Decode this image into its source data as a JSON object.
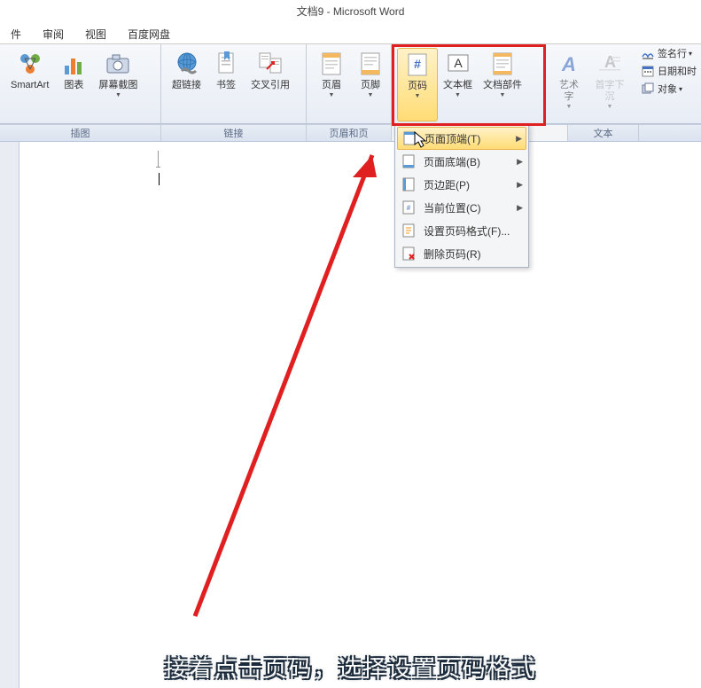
{
  "title": "文档9 - Microsoft Word",
  "menu": {
    "items": [
      "件",
      "审阅",
      "视图",
      "百度网盘"
    ]
  },
  "ribbon": {
    "smartart": "SmartArt",
    "chart": "图表",
    "screenshot": "屏幕截图",
    "hyperlink": "超链接",
    "bookmark": "书签",
    "crossref": "交叉引用",
    "header": "页眉",
    "footer": "页脚",
    "pagenum": "页码",
    "textbox": "文本框",
    "docparts": "文档部件",
    "wordart": "艺术字",
    "dropcap": "首字下沉"
  },
  "groups": {
    "illustration": "插图",
    "links": "链接",
    "headerfooter": "页眉和页",
    "text": "文本"
  },
  "dropdown": {
    "top": "页面顶端(T)",
    "bottom": "页面底端(B)",
    "margin": "页边距(P)",
    "current": "当前位置(C)",
    "format": "设置页码格式(F)...",
    "remove": "删除页码(R)"
  },
  "side": {
    "sign": "签名行",
    "datetime": "日期和时",
    "object": "对象"
  },
  "caption": "接着点击页码，选择设置页码格式"
}
